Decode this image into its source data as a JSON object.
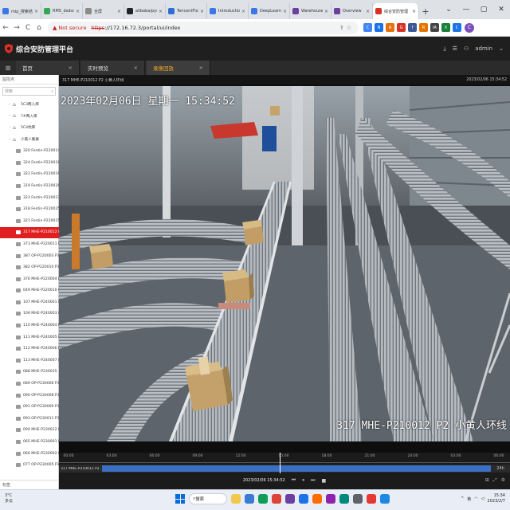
{
  "browser": {
    "tabs": [
      {
        "title": "mlp_搜索结果",
        "color": "#3b78e7"
      },
      {
        "title": "RMS_dsdsds",
        "color": "#34a853"
      },
      {
        "title": "全屏",
        "color": "#8a8a8a"
      },
      {
        "title": "alibaba/pycr",
        "color": "#222222"
      },
      {
        "title": "TencentFlow",
        "color": "#2b6fd6"
      },
      {
        "title": "Introductio",
        "color": "#3b78e7"
      },
      {
        "title": "DeepLearnin",
        "color": "#3b78e7"
      },
      {
        "title": "Warehouse",
        "color": "#6b3fa0"
      },
      {
        "title": "Overview",
        "color": "#6b3fa0"
      },
      {
        "title": "综合安防管理",
        "color": "#d93025",
        "active": true
      }
    ],
    "new_tab": "+",
    "window_controls": [
      "⌄",
      "—",
      "▢",
      "✕"
    ],
    "nav": {
      "back": "←",
      "forward": "→",
      "reload": "C",
      "home": "⌂"
    },
    "security_label": "Not secure",
    "url_scheme": "https",
    "url_rest": "://172.16.72.3/portal/ui/index",
    "extensions": [
      {
        "label": "C",
        "color": "#4285f4"
      },
      {
        "label": "N",
        "color": "#1a73e8"
      },
      {
        "label": "A",
        "color": "#e8710a"
      },
      {
        "label": "G",
        "color": "#d93025"
      },
      {
        "label": "f",
        "color": "#3b5998"
      },
      {
        "label": "R",
        "color": "#e37400"
      },
      {
        "label": "IA",
        "color": "#444444"
      },
      {
        "label": "X",
        "color": "#188038"
      },
      {
        "label": "C",
        "color": "#1a73e8"
      }
    ],
    "profile_initial": "C"
  },
  "app": {
    "title": "综合安防管理平台",
    "user": "admin",
    "header_icons": [
      "download-icon",
      "settings-icon",
      "user-icon"
    ],
    "nav_tabs": [
      {
        "label": "首页",
        "active": false
      },
      {
        "label": "实时预览",
        "active": false
      },
      {
        "label": "录像回放",
        "active": true
      }
    ]
  },
  "left_panel": {
    "title": "监控点",
    "search_placeholder": "搜索",
    "groups": [
      {
        "label": "5C3两入库"
      },
      {
        "label": "7#两入库"
      },
      {
        "label": "5C4地库"
      },
      {
        "label": "小黄人集群"
      }
    ],
    "cameras": [
      {
        "label": "320 Fentin-P220014",
        "selected": false
      },
      {
        "label": "324 Fentin-P220018",
        "selected": false
      },
      {
        "label": "322 Fentin-P220016",
        "selected": false
      },
      {
        "label": "319 Fentin-P220026",
        "selected": false
      },
      {
        "label": "323 Fentin-P220017",
        "selected": false
      },
      {
        "label": "318 Fentin-P220025",
        "selected": false
      },
      {
        "label": "321 Fentin-P220015",
        "selected": false
      },
      {
        "label": "317 MHE-P210012 P",
        "selected": true
      },
      {
        "label": "373 MHE-P220011 P",
        "selected": false
      },
      {
        "label": "387 OP-P220003 P3",
        "selected": false
      },
      {
        "label": "382 OP-P220010 P3",
        "selected": false
      },
      {
        "label": "376 MHE-P220004 P",
        "selected": false
      },
      {
        "label": "049 MHE-P220010 P",
        "selected": false
      },
      {
        "label": "107 MHE-P240001 P",
        "selected": false
      },
      {
        "label": "109 MHE-P240003 P",
        "selected": false
      },
      {
        "label": "110 MHE-P240004 P",
        "selected": false
      },
      {
        "label": "111 MHE-P240005 P",
        "selected": false
      },
      {
        "label": "112 MHE-P240006 P",
        "selected": false
      },
      {
        "label": "113 MHE-P240007 P",
        "selected": false
      },
      {
        "label": "088 MHE-P230035",
        "selected": false
      },
      {
        "label": "089 OP-P230006 P3",
        "selected": false
      },
      {
        "label": "090 OP-P230008 P3",
        "selected": false
      },
      {
        "label": "091 OP-P230009 P3",
        "selected": false
      },
      {
        "label": "093 OP-P230011 P3",
        "selected": false
      },
      {
        "label": "094 MHE-P230012 P",
        "selected": false
      },
      {
        "label": "065 MHE-P230001 P",
        "selected": false
      },
      {
        "label": "066 MHE-P230002 P",
        "selected": false
      },
      {
        "label": "077 OP-P230005 P3",
        "selected": false
      }
    ],
    "bottom_label": "标签"
  },
  "video": {
    "header_label": "317 MHE-P210012 P2 小黄人环线",
    "header_timestamp": "2023/02/06 15:34:52",
    "osd_datetime": "2023年02月06日 星期一 15:34:52",
    "osd_camera": "317 MHE-P210012 P2 小黄人环线"
  },
  "timeline": {
    "ruler_labels": [
      "00:00",
      "03:00",
      "06:00",
      "09:00",
      "12:00",
      "15:00",
      "18:00",
      "21:00",
      "24:00",
      "03:00",
      "06:00"
    ],
    "track_label": "317 MHE-P210012 P2 ...",
    "track_right": "24h",
    "cursor_fraction": 0.49,
    "current_datetime": "2023/02/06 15:34:52",
    "controls": [
      "⏮",
      "⏸",
      "⏭",
      "■"
    ],
    "right_icons": [
      "⊞",
      "⤢",
      "⚙"
    ]
  },
  "taskbar": {
    "weather_temp": "3°C",
    "weather_desc": "多云",
    "search_label": "搜索",
    "app_icon_colors": [
      "#f2c94c",
      "#3a7bd5",
      "#0f9d58",
      "#db4437",
      "#6b3fa0",
      "#1a73e8",
      "#ff6d00",
      "#8e24aa",
      "#00897b",
      "#5f6368",
      "#e53935",
      "#1e88e5"
    ],
    "lang": "英",
    "time": "15:34",
    "date": "2023/2/7"
  }
}
